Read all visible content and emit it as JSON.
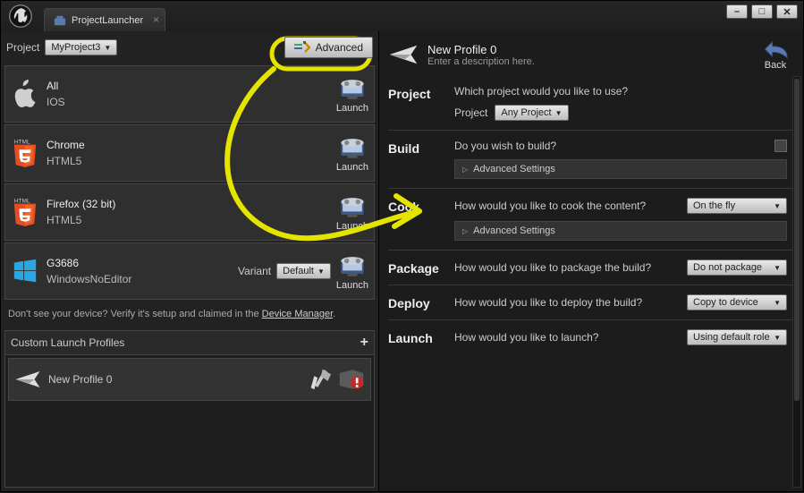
{
  "tab": {
    "title": "ProjectLauncher"
  },
  "left": {
    "project_label": "Project",
    "project_value": "MyProject3",
    "advanced_label": "Advanced",
    "devices": [
      {
        "title": "All",
        "sub": "IOS",
        "platform": "apple",
        "variant": null
      },
      {
        "title": "Chrome",
        "sub": "HTML5",
        "platform": "html5",
        "variant": null
      },
      {
        "title": "Firefox (32 bit)",
        "sub": "HTML5",
        "platform": "html5",
        "variant": null
      },
      {
        "title": "G3686",
        "sub": "WindowsNoEditor",
        "platform": "windows",
        "variant": "Default"
      }
    ],
    "launch_label": "Launch",
    "variant_label": "Variant",
    "help_prefix": "Don't see your device? Verify it's setup and claimed in the ",
    "help_link": "Device Manager",
    "help_suffix": ".",
    "profiles_header": "Custom Launch Profiles",
    "profiles": [
      {
        "name": "New Profile 0"
      }
    ]
  },
  "right": {
    "profile_name": "New Profile 0",
    "profile_desc": "Enter a description here.",
    "back_label": "Back",
    "sections": {
      "project": {
        "label": "Project",
        "question": "Which project would you like to use?",
        "field_label": "Project",
        "value": "Any Project"
      },
      "build": {
        "label": "Build",
        "question": "Do you wish to build?",
        "advanced": "Advanced Settings"
      },
      "cook": {
        "label": "Cook",
        "question": "How would you like to cook the content?",
        "value": "On the fly",
        "advanced": "Advanced Settings"
      },
      "package": {
        "label": "Package",
        "question": "How would you like to package the build?",
        "value": "Do not package"
      },
      "deploy": {
        "label": "Deploy",
        "question": "How would you like to deploy the build?",
        "value": "Copy to device"
      },
      "launch": {
        "label": "Launch",
        "question": "How would you like to launch?",
        "value": "Using default role"
      }
    }
  }
}
